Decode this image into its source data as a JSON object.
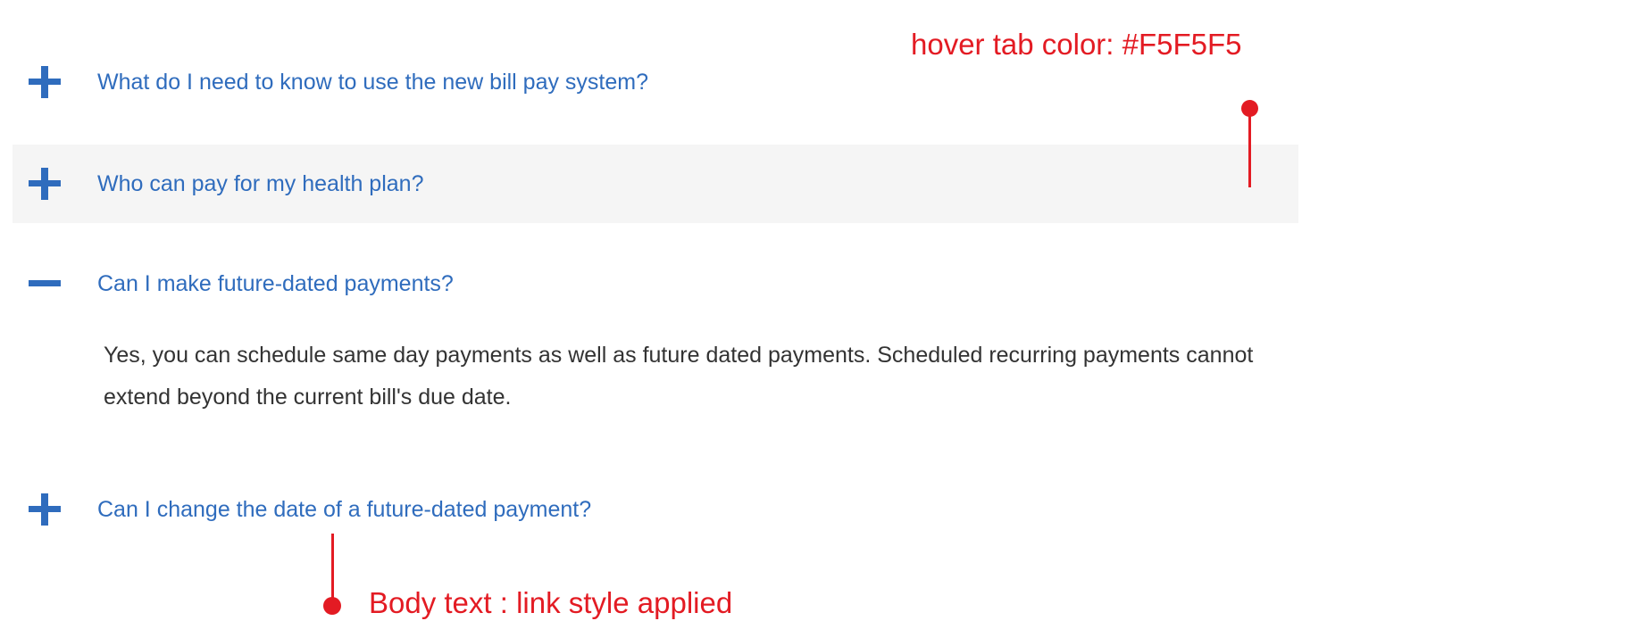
{
  "faq": {
    "items": [
      {
        "question": "What do I need to know to use the new bill pay system?",
        "state": "collapsed",
        "hovered": false
      },
      {
        "question": "Who can pay for my health plan?",
        "state": "collapsed",
        "hovered": true
      },
      {
        "question": "Can I make future-dated payments?",
        "state": "expanded",
        "hovered": false,
        "answer": "Yes, you can schedule same day payments as well as future dated payments. Scheduled recurring payments cannot extend beyond the current bill's due date."
      },
      {
        "question": "Can I change the date of a future-dated payment?",
        "state": "collapsed",
        "hovered": false
      }
    ]
  },
  "annotations": {
    "hover_tab": "hover tab color: #F5F5F5",
    "body_text_link": "Body text : link style applied"
  },
  "colors": {
    "question_link": "#2f6cbd",
    "hover_tab": "#F5F5F5",
    "answer_text": "#333333",
    "annotation": "#e31b23"
  },
  "icons": {
    "collapsed": "plus-icon",
    "expanded": "minus-icon",
    "annotation_marker": "dot-marker"
  }
}
